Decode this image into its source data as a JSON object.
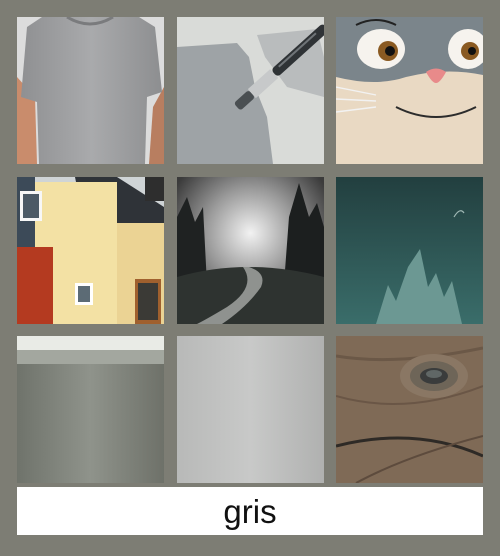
{
  "caption": "gris",
  "colors": {
    "frame": "#7d7d74",
    "caption_bg": "#ffffff",
    "caption_text": "#111111"
  },
  "tiles": [
    {
      "id": "tshirt",
      "subject": "grey-tshirt"
    },
    {
      "id": "paint",
      "subject": "paintbrush-grey-paint"
    },
    {
      "id": "cat",
      "subject": "cartoon-grey-cat"
    },
    {
      "id": "house",
      "subject": "yellow-house-grey-wall"
    },
    {
      "id": "forest",
      "subject": "misty-forest-path"
    },
    {
      "id": "teal",
      "subject": "teal-misty-spires"
    },
    {
      "id": "cup",
      "subject": "grey-ceramic-cup"
    },
    {
      "id": "gradient",
      "subject": "grey-gradient-swatch"
    },
    {
      "id": "wood",
      "subject": "grey-wood-knot"
    }
  ]
}
